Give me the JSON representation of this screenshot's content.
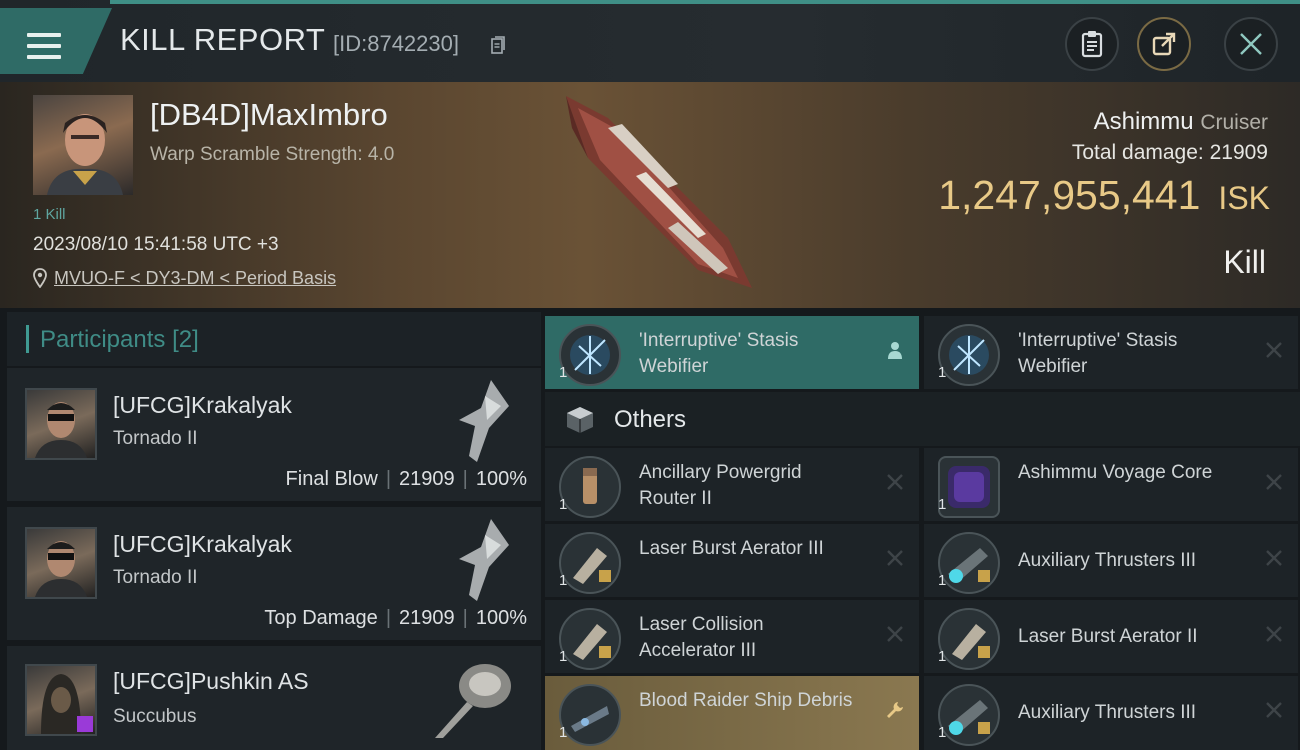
{
  "header": {
    "title": "KILL REPORT",
    "report_id": "[ID:8742230]"
  },
  "victim": {
    "name": "[DB4D]MaxImbro",
    "warp_scramble": "Warp Scramble Strength: 4.0",
    "kill_count": "1 Kill",
    "datetime": "2023/08/10 15:41:58 UTC +3",
    "location": "MVUO-F < DY3-DM < Period Basis",
    "ship_name": "Ashimmu",
    "ship_class": "Cruiser",
    "total_damage_label": "Total damage:",
    "total_damage": "21909",
    "isk_value": "1,247,955,441",
    "isk_unit": "ISK",
    "result": "Kill"
  },
  "participants": {
    "title": "Participants",
    "count": "[2]",
    "rows": [
      {
        "name": "[UFCG]Krakalyak",
        "ship": "Tornado II",
        "role": "Final Blow",
        "damage": "21909",
        "percent": "100%"
      },
      {
        "name": "[UFCG]Krakalyak",
        "ship": "Tornado II",
        "role": "Top Damage",
        "damage": "21909",
        "percent": "100%"
      },
      {
        "name": "[UFCG]Pushkin AS",
        "ship": "Succubus"
      }
    ]
  },
  "modules": {
    "top": [
      {
        "qty": "1",
        "name": "'Interruptive' Stasis Webifier"
      },
      {
        "qty": "1",
        "name": "'Interruptive' Stasis Webifier"
      }
    ],
    "others_title": "Others",
    "others": [
      {
        "qty": "1",
        "name": "Ancillary Powergrid Router II"
      },
      {
        "qty": "1",
        "name": "Ashimmu Voyage Core"
      },
      {
        "qty": "1",
        "name": "Laser Burst Aerator III"
      },
      {
        "qty": "1",
        "name": "Auxiliary Thrusters III"
      },
      {
        "qty": "1",
        "name": "Laser Collision Accelerator III"
      },
      {
        "qty": "1",
        "name": "Laser Burst Aerator II"
      },
      {
        "qty": "1",
        "name": "Blood Raider Ship Debris"
      },
      {
        "qty": "1",
        "name": "Auxiliary Thrusters III"
      }
    ]
  },
  "colors": {
    "accent_teal": "#2f6b66",
    "isk_gold": "#e8c987",
    "highlight_gold": "#8a7850"
  }
}
